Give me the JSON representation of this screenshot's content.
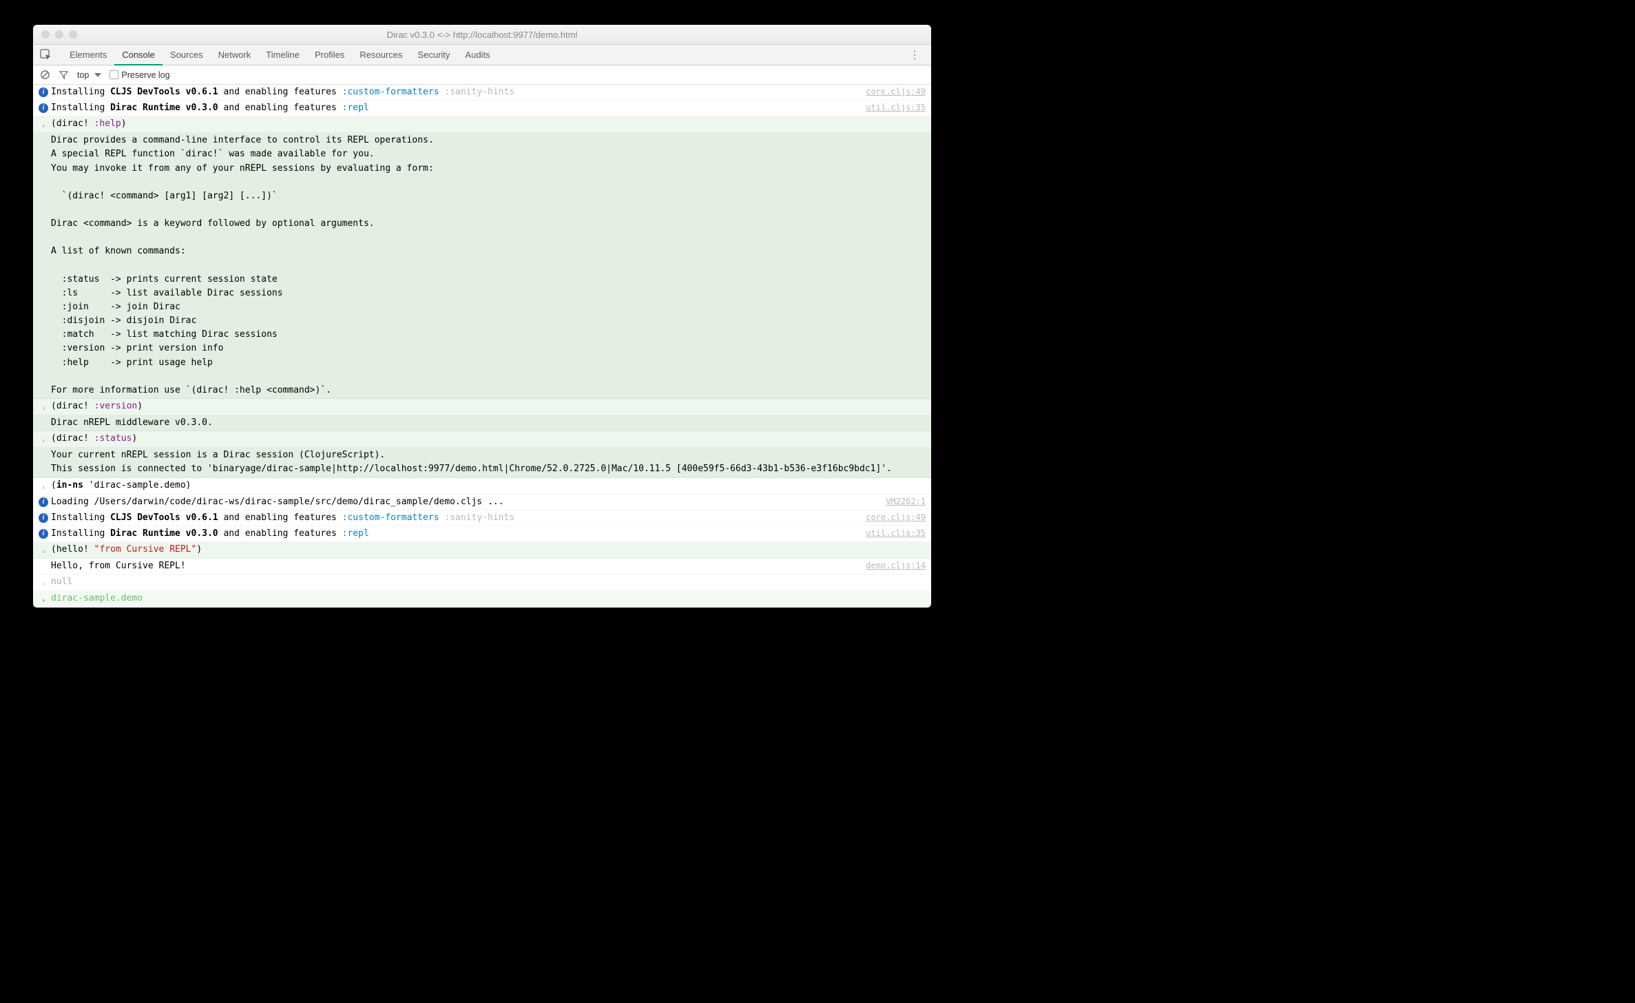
{
  "window": {
    "title": "Dirac v0.3.0 <-> http://localhost:9977/demo.html"
  },
  "tabs": {
    "items": [
      "Elements",
      "Console",
      "Sources",
      "Network",
      "Timeline",
      "Profiles",
      "Resources",
      "Security",
      "Audits"
    ],
    "active_index": 1
  },
  "toolbar": {
    "context": "top",
    "preserve_log_label": "Preserve log"
  },
  "rows": [
    {
      "type": "info",
      "prefix": "Installing ",
      "bold": "CLJS DevTools v0.6.1",
      "suffix": " and enabling features ",
      "kw": ":custom-formatters",
      "kw2": ":sanity-hints",
      "source": "core.cljs:49"
    },
    {
      "type": "info",
      "prefix": "Installing ",
      "bold": "Dirac Runtime v0.3.0",
      "suffix": " and enabling features ",
      "kw": ":repl",
      "source": "util.cljs:35"
    },
    {
      "type": "input-green",
      "open": "(dirac! ",
      "kw": ":help",
      "close": ")"
    },
    {
      "type": "block",
      "text": "Dirac provides a command-line interface to control its REPL operations.\nA special REPL function `dirac!` was made available for you.\nYou may invoke it from any of your nREPL sessions by evaluating a form:\n\n  `(dirac! <command> [arg1] [arg2] [...])`\n\nDirac <command> is a keyword followed by optional arguments.\n\nA list of known commands:\n\n  :status  -> prints current session state\n  :ls      -> list available Dirac sessions\n  :join    -> join Dirac\n  :disjoin -> disjoin Dirac\n  :match   -> list matching Dirac sessions\n  :version -> print version info\n  :help    -> print usage help\n\nFor more information use `(dirac! :help <command>)`."
    },
    {
      "type": "input-green",
      "open": "(dirac! ",
      "kw": ":version",
      "close": ")"
    },
    {
      "type": "block-short",
      "text": "Dirac nREPL middleware v0.3.0."
    },
    {
      "type": "input-green",
      "open": "(dirac! ",
      "kw": ":status",
      "close": ")"
    },
    {
      "type": "block-short",
      "text": "Your current nREPL session is a Dirac session (ClojureScript).\nThis session is connected to 'binaryage/dirac-sample|http://localhost:9977/demo.html|Chrome/52.0.2725.0|Mac/10.11.5 [400e59f5-66d3-43b1-b536-e3f16bc9bdc1]'."
    },
    {
      "type": "input-plain",
      "open": "(",
      "bold": "in-ns",
      "rest": " 'dirac-sample.demo)"
    },
    {
      "type": "info-plain",
      "text": "Loading /Users/darwin/code/dirac-ws/dirac-sample/src/demo/dirac_sample/demo.cljs ...",
      "source": "VM2262:1"
    },
    {
      "type": "info",
      "prefix": "Installing ",
      "bold": "CLJS DevTools v0.6.1",
      "suffix": " and enabling features ",
      "kw": ":custom-formatters",
      "kw2": ":sanity-hints",
      "source": "core.cljs:49"
    },
    {
      "type": "info",
      "prefix": "Installing ",
      "bold": "Dirac Runtime v0.3.0",
      "suffix": " and enabling features ",
      "kw": ":repl",
      "source": "util.cljs:35"
    },
    {
      "type": "input-green-str",
      "open": "(hello! ",
      "str": "\"from Cursive REPL\"",
      "close": ")"
    },
    {
      "type": "output",
      "text": "Hello, from Cursive REPL!",
      "source": "demo.cljs:14"
    },
    {
      "type": "return",
      "text": "null"
    },
    {
      "type": "prompt",
      "text": "dirac-sample.demo"
    }
  ]
}
